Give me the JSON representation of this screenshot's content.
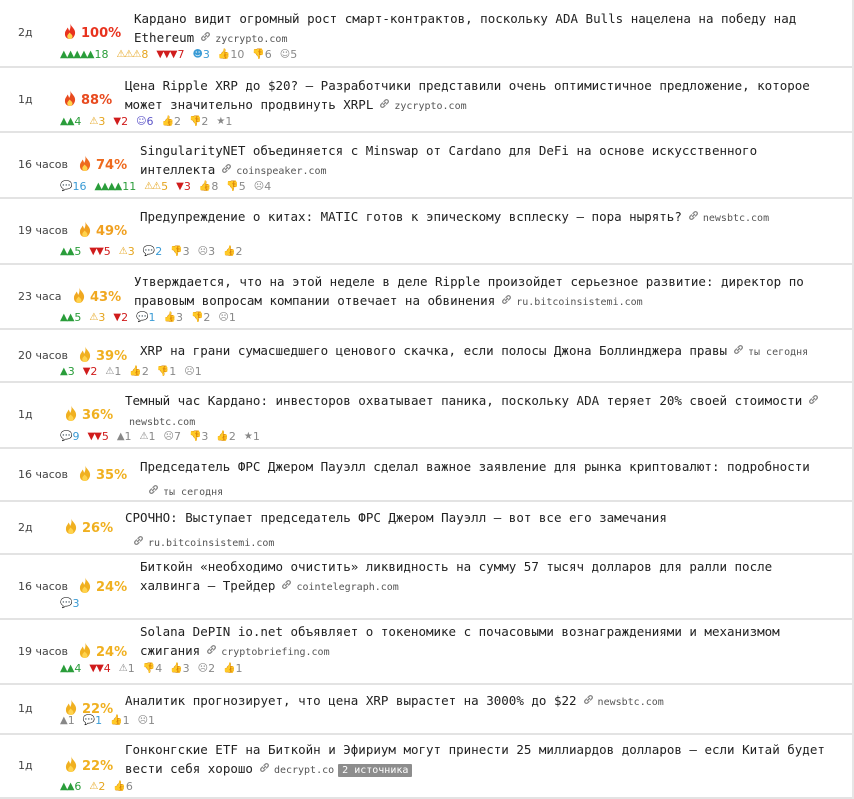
{
  "rows": [
    {
      "age": "2д",
      "hot": "100%",
      "hot_color": "#e8321e",
      "title": "Кардано видит огромный рост смарт-контрактов, поскольку ADA Bulls нацелена на победу над Ethereum",
      "domain": "zycrypto.com",
      "badge": "",
      "stats": [
        {
          "k": "bull",
          "icon": "▲▲▲▲▲",
          "v": "18"
        },
        {
          "k": "warn",
          "icon": "⚠⚠⚠",
          "v": "8"
        },
        {
          "k": "bear",
          "icon": "▼▼▼",
          "v": "7"
        },
        {
          "k": "blue",
          "icon": "☻",
          "v": "3"
        },
        {
          "k": "gray",
          "icon": "👍",
          "v": "10"
        },
        {
          "k": "gray",
          "icon": "👎",
          "v": "6"
        },
        {
          "k": "gray",
          "icon": "☺",
          "v": "5"
        }
      ]
    },
    {
      "age": "1д",
      "hot": "88%",
      "hot_color": "#e84a1e",
      "title": "Цена Ripple XRP до $20? — Разработчики представили очень оптимистичное предложение, которое может значительно продвинуть XRPL",
      "domain": "zycrypto.com",
      "badge": "",
      "stats": [
        {
          "k": "bull",
          "icon": "▲▲",
          "v": "4"
        },
        {
          "k": "warn",
          "icon": "⚠",
          "v": "3"
        },
        {
          "k": "bear",
          "icon": "▼",
          "v": "2"
        },
        {
          "k": "purple",
          "icon": "☺",
          "v": "6"
        },
        {
          "k": "gray",
          "icon": "👍",
          "v": "2"
        },
        {
          "k": "gray",
          "icon": "👎",
          "v": "2"
        },
        {
          "k": "gray",
          "icon": "★",
          "v": "1"
        }
      ]
    },
    {
      "age": "16 часов",
      "hot": "74%",
      "hot_color": "#ee6a1e",
      "title": "SingularityNET объединяется с Minswap от Cardano для DeFi на основе искусственного интеллекта",
      "domain": "coinspeaker.com",
      "badge": "",
      "stats": [
        {
          "k": "blue",
          "icon": "💬",
          "v": "16"
        },
        {
          "k": "bull",
          "icon": "▲▲▲▲",
          "v": "11"
        },
        {
          "k": "warn",
          "icon": "⚠⚠",
          "v": "5"
        },
        {
          "k": "bear",
          "icon": "▼",
          "v": "3"
        },
        {
          "k": "gray",
          "icon": "👍",
          "v": "8"
        },
        {
          "k": "gray",
          "icon": "👎",
          "v": "5"
        },
        {
          "k": "gray",
          "icon": "☹",
          "v": "4"
        }
      ]
    },
    {
      "age": "19 часов",
      "hot": "49%",
      "hot_color": "#f0a020",
      "title": "Предупреждение о китах: MATIC готов к эпическому всплеску – пора нырять?",
      "domain": "newsbtc.com",
      "badge": "",
      "stats": [
        {
          "k": "bull",
          "icon": "▲▲",
          "v": "5"
        },
        {
          "k": "bear",
          "icon": "▼▼",
          "v": "5"
        },
        {
          "k": "warn",
          "icon": "⚠",
          "v": "3"
        },
        {
          "k": "blue",
          "icon": "💬",
          "v": "2"
        },
        {
          "k": "gray",
          "icon": "👎",
          "v": "3"
        },
        {
          "k": "gray",
          "icon": "☹",
          "v": "3"
        },
        {
          "k": "gray",
          "icon": "👍",
          "v": "2"
        }
      ]
    },
    {
      "age": "23 часа",
      "hot": "43%",
      "hot_color": "#f0a820",
      "title": "Утверждается, что на этой неделе в деле Ripple произойдет серьезное развитие: директор по правовым вопросам компании отвечает на обвинения",
      "domain": "ru.bitcoinsistemi.com",
      "badge": "",
      "stats": [
        {
          "k": "bull",
          "icon": "▲▲",
          "v": "5"
        },
        {
          "k": "warn",
          "icon": "⚠",
          "v": "3"
        },
        {
          "k": "bear",
          "icon": "▼",
          "v": "2"
        },
        {
          "k": "blue",
          "icon": "💬",
          "v": "1"
        },
        {
          "k": "gray",
          "icon": "👍",
          "v": "3"
        },
        {
          "k": "gray",
          "icon": "👎",
          "v": "2"
        },
        {
          "k": "gray",
          "icon": "☹",
          "v": "1"
        }
      ]
    },
    {
      "age": "20 часов",
      "hot": "39%",
      "hot_color": "#f0b020",
      "title": "XRP на грани сумасшедшего ценового скачка, если полосы Джона Боллинджера правы",
      "domain": "ты сегодня",
      "badge": "",
      "stats": [
        {
          "k": "bull",
          "icon": "▲",
          "v": "3"
        },
        {
          "k": "bear",
          "icon": "▼",
          "v": "2"
        },
        {
          "k": "gray",
          "icon": "⚠",
          "v": "1"
        },
        {
          "k": "gray",
          "icon": "👍",
          "v": "2"
        },
        {
          "k": "gray",
          "icon": "👎",
          "v": "1"
        },
        {
          "k": "gray",
          "icon": "☹",
          "v": "1"
        }
      ]
    },
    {
      "age": "1д",
      "hot": "36%",
      "hot_color": "#f0b020",
      "title": "Темный час Кардано: инвесторов охватывает паника, поскольку ADA теряет 20% своей стоимости",
      "domain": "newsbtc.com",
      "badge": "",
      "stats": [
        {
          "k": "blue",
          "icon": "💬",
          "v": "9"
        },
        {
          "k": "bear",
          "icon": "▼▼",
          "v": "5"
        },
        {
          "k": "gray",
          "icon": "▲",
          "v": "1"
        },
        {
          "k": "gray",
          "icon": "⚠",
          "v": "1"
        },
        {
          "k": "gray",
          "icon": "☹",
          "v": "7"
        },
        {
          "k": "gray",
          "icon": "👎",
          "v": "3"
        },
        {
          "k": "gray",
          "icon": "👍",
          "v": "2"
        },
        {
          "k": "gray",
          "icon": "★",
          "v": "1"
        }
      ]
    },
    {
      "age": "16 часов",
      "hot": "35%",
      "hot_color": "#f0b020",
      "title": "Председатель ФРС Джером Пауэлл сделал важное заявление для рынка криптовалют: подробности",
      "domain": "ты сегодня",
      "badge": "",
      "stats": []
    },
    {
      "age": "2д",
      "hot": "26%",
      "hot_color": "#f0b020",
      "title": "СРОЧНО: Выступает председатель ФРС Джером Пауэлл – вот все его замечания",
      "domain": "ru.bitcoinsistemi.com",
      "badge": "",
      "stats": []
    },
    {
      "age": "16 часов",
      "hot": "24%",
      "hot_color": "#f0b020",
      "title": "Биткойн «необходимо очистить» ликвидность на сумму 57 тысяч долларов для ралли после халвинга — Трейдер",
      "domain": "cointelegraph.com",
      "badge": "",
      "stats": [
        {
          "k": "blue",
          "icon": "💬",
          "v": "3"
        }
      ]
    },
    {
      "age": "19 часов",
      "hot": "24%",
      "hot_color": "#f0b020",
      "title": "Solana DePIN io.net объявляет о токеномике с почасовыми вознаграждениями и механизмом сжигания",
      "domain": "cryptobriefing.com",
      "badge": "",
      "stats": [
        {
          "k": "bull",
          "icon": "▲▲",
          "v": "4"
        },
        {
          "k": "bear",
          "icon": "▼▼",
          "v": "4"
        },
        {
          "k": "gray",
          "icon": "⚠",
          "v": "1"
        },
        {
          "k": "gray",
          "icon": "👎",
          "v": "4"
        },
        {
          "k": "gray",
          "icon": "👍",
          "v": "3"
        },
        {
          "k": "gray",
          "icon": "☹",
          "v": "2"
        },
        {
          "k": "gray",
          "icon": "👍",
          "v": "1"
        }
      ]
    },
    {
      "age": "1д",
      "hot": "22%",
      "hot_color": "#f0b020",
      "title": "Аналитик прогнозирует, что цена XRP вырастет на 3000% до $22",
      "domain": "newsbtc.com",
      "badge": "",
      "stats": [
        {
          "k": "gray",
          "icon": "▲",
          "v": "1"
        },
        {
          "k": "blue",
          "icon": "💬",
          "v": "1"
        },
        {
          "k": "gray",
          "icon": "👍",
          "v": "1"
        },
        {
          "k": "gray",
          "icon": "☹",
          "v": "1"
        }
      ]
    },
    {
      "age": "1д",
      "hot": "22%",
      "hot_color": "#f0b020",
      "title": "Гонконгские ETF на Биткойн и Эфириум могут принести 25 миллиардов долларов — если Китай будет вести себя хорошо",
      "domain": "decrypt.co",
      "badge": "2 источника",
      "stats": [
        {
          "k": "bull",
          "icon": "▲▲",
          "v": "6"
        },
        {
          "k": "warn",
          "icon": "⚠",
          "v": "2"
        },
        {
          "k": "gray",
          "icon": "👍",
          "v": "6"
        }
      ]
    }
  ]
}
